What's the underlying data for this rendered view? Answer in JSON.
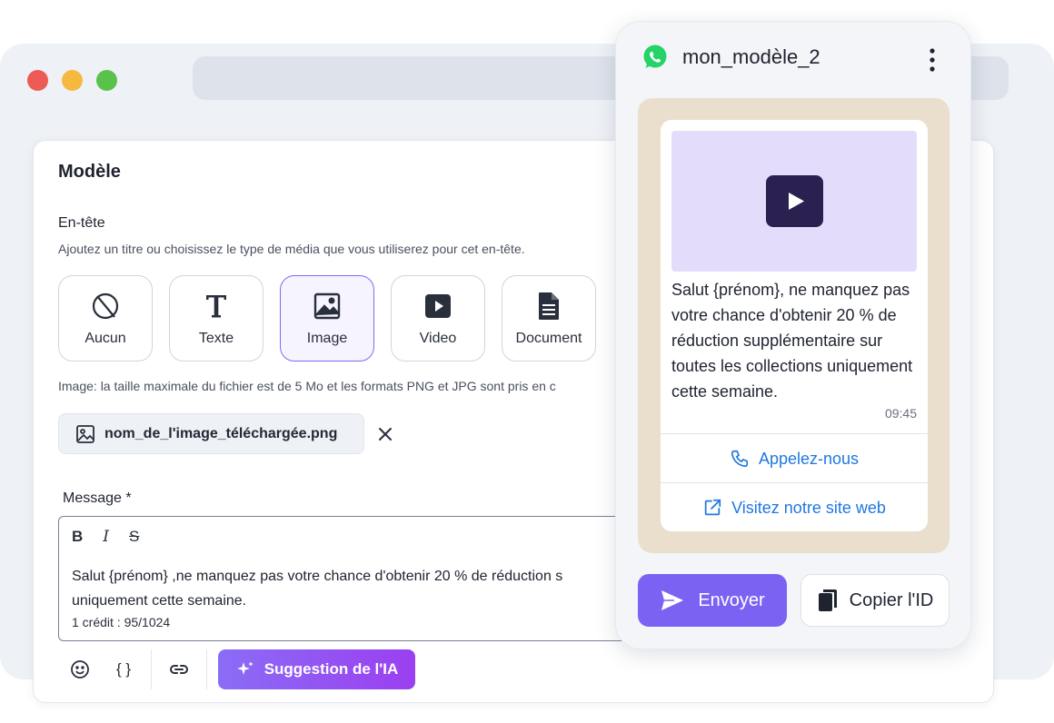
{
  "form": {
    "title": "Modèle",
    "header_label": "En-tête",
    "header_description": "Ajoutez un titre ou choisissez le type de média que vous utiliserez pour cet en-tête.",
    "media_options": [
      {
        "label": "Aucun",
        "icon": "no-media-icon"
      },
      {
        "label": "Texte",
        "icon": "text-icon"
      },
      {
        "label": "Image",
        "icon": "image-icon",
        "selected": true
      },
      {
        "label": "Video",
        "icon": "video-icon"
      },
      {
        "label": "Document",
        "icon": "document-icon"
      }
    ],
    "image_note": "Image: la taille maximale du fichier est de 5 Mo et les formats PNG et JPG sont pris en c",
    "uploaded_file": "nom_de_l'image_téléchargée.png",
    "message_label": "Message *",
    "format_bold": "B",
    "format_italic": "I",
    "format_strike": "S",
    "message_line1": "Salut {prénom} ,ne manquez pas votre chance d'obtenir 20 % de réduction s",
    "message_line2": "uniquement cette semaine.",
    "credit": "1 crédit : 95/1024",
    "variables_label": "{ }",
    "ai_button": "Suggestion de l'IA"
  },
  "preview": {
    "template_name": "mon_modèle_2",
    "message": "Salut  {prénom}, ne manquez pas votre chance d'obtenir 20 % de réduction supplémentaire sur toutes les collections uniquement cette semaine.",
    "time": "09:45",
    "action_call": "Appelez-nous",
    "action_visit": "Visitez notre site web",
    "send_button": "Envoyer",
    "copy_button": "Copier l'ID"
  },
  "colors": {
    "accent": "#7c62f3",
    "link": "#1f78e0",
    "whatsapp_green": "#25d366",
    "chat_bg": "#e9dfcc"
  }
}
